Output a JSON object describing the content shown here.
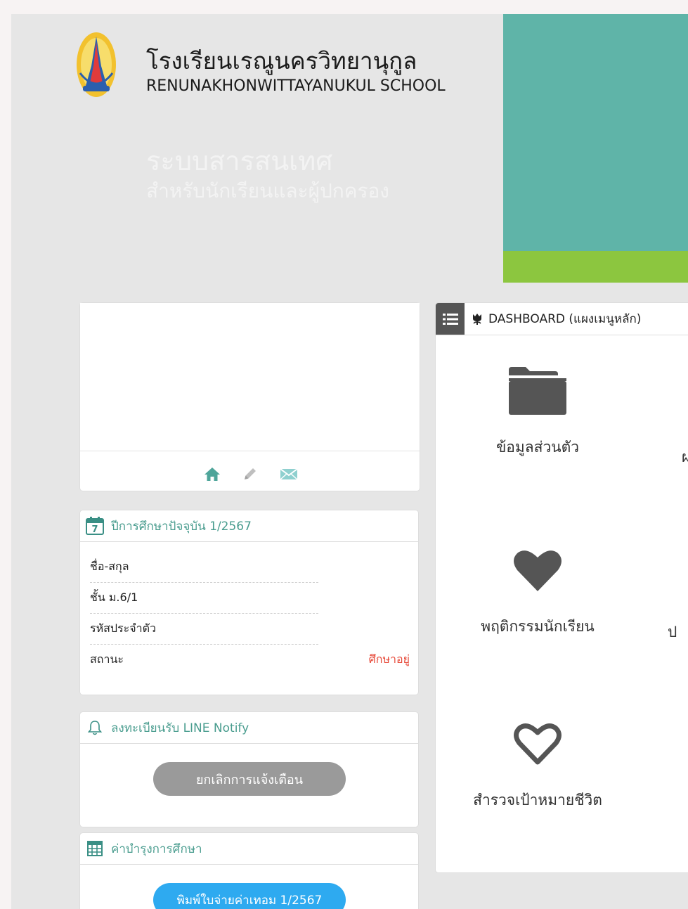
{
  "header": {
    "school_name_th": "โรงเรียนเรณูนครวิทยานุกูล",
    "school_name_en": "RENUNAKHONWITTAYANUKUL  SCHOOL",
    "system_title": "ระบบสารสนเทศ",
    "system_subtitle": "สำหรับนักเรียนและผู้ปกครอง"
  },
  "colors": {
    "banner_teal": "#5fb4a8",
    "banner_green": "#8cc63f",
    "accent_teal_text": "#4a9d8f",
    "status_red": "#e74c3c",
    "button_blue": "#2eaaf0",
    "button_gray": "#9a9a9a"
  },
  "profile": {
    "icons": [
      "home-icon",
      "pencil-icon",
      "mail-icon"
    ]
  },
  "year_card": {
    "title": "ปีการศึกษาปัจจุบัน 1/2567",
    "calendar_day": "7",
    "rows": [
      {
        "label": "ชื่อ-สกุล"
      },
      {
        "label": "ชั้น ม.6/1"
      },
      {
        "label": "รหัสประจำตัว"
      }
    ],
    "status_label": "สถานะ",
    "status_value": "ศึกษาอยู่"
  },
  "line_card": {
    "title": "ลงทะเบียนรับ LINE Notify",
    "button": "ยกเลิกการแจ้งเตือน"
  },
  "fee_card": {
    "title": "ค่าบำรุงการศึกษา",
    "button": "พิมพ์ใบจ่ายค่าเทอม 1/2567"
  },
  "dashboard": {
    "title": "DASHBOARD (แผงเมนูหลัก)",
    "tiles": [
      {
        "label": "ข้อมูลส่วนตัว",
        "icon": "folder-icon"
      },
      {
        "label": "พฤติกรรมนักเรียน",
        "icon": "heart-icon"
      },
      {
        "label": "สำรวจเป้าหมายชีวิต",
        "icon": "heart-outline-icon"
      }
    ],
    "partial_labels": [
      "ผ",
      "ป"
    ]
  }
}
